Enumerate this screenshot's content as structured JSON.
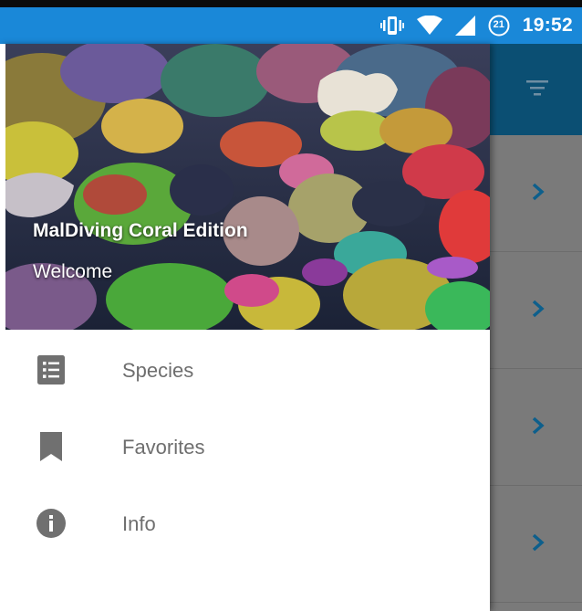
{
  "status_bar": {
    "time": "19:52",
    "notification_badge": "21",
    "icons": [
      "vibrate-icon",
      "wifi-icon",
      "signal-icon",
      "notification-badge-icon"
    ]
  },
  "drawer": {
    "app_title": "MalDiving Coral Edition",
    "subtitle": "Welcome",
    "items": [
      {
        "label": "Species",
        "icon": "list-icon"
      },
      {
        "label": "Favorites",
        "icon": "bookmark-icon"
      },
      {
        "label": "Info",
        "icon": "info-icon"
      }
    ]
  },
  "background_page": {
    "header_icon": "filter-icon",
    "rows": [
      "chevron-right-icon",
      "chevron-right-icon",
      "chevron-right-icon",
      "chevron-right-icon"
    ]
  },
  "colors": {
    "status_bar": "#1a88d8",
    "toolbar": "#0b4f73",
    "chevron": "#0d5f8c",
    "menu_icon": "#707070",
    "menu_text": "#6e6e6e",
    "scrim_area": "#7a7a7a"
  }
}
